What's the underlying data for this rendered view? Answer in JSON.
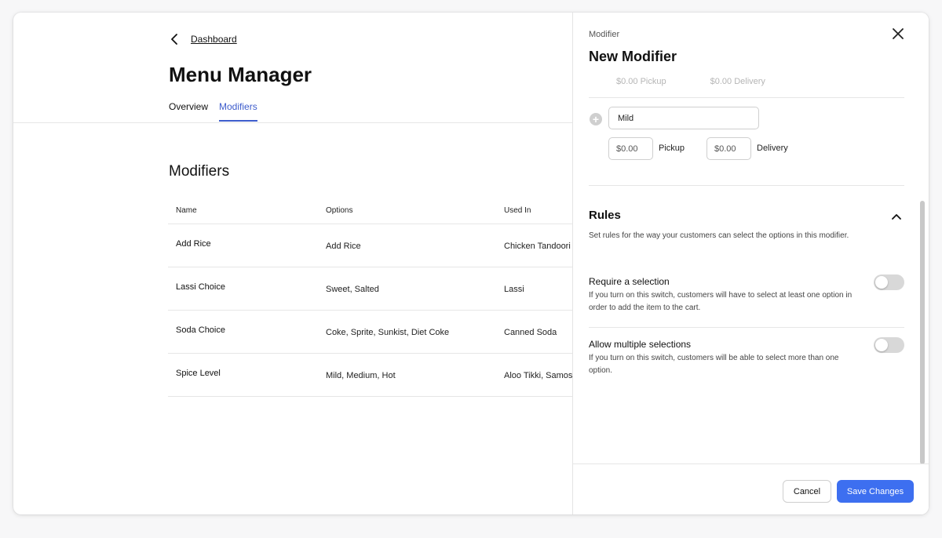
{
  "breadcrumb": {
    "back_label": "Dashboard"
  },
  "page": {
    "title": "Menu Manager",
    "tabs": [
      {
        "label": "Overview",
        "active": false
      },
      {
        "label": "Modifiers",
        "active": true
      }
    ]
  },
  "modifiers_section": {
    "title": "Modifiers",
    "columns": [
      "Name",
      "Options",
      "Used In"
    ],
    "rows": [
      {
        "name": "Add Rice",
        "options": "Add Rice",
        "used_in": "Chicken Tandoori"
      },
      {
        "name": "Lassi Choice",
        "options": "Sweet, Salted",
        "used_in": "Lassi"
      },
      {
        "name": "Soda Choice",
        "options": "Coke, Sprite, Sunkist, Diet Coke",
        "used_in": "Canned Soda"
      },
      {
        "name": "Spice Level",
        "options": "Mild, Medium, Hot",
        "used_in": "Aloo Tikki, Samosa"
      }
    ]
  },
  "drawer": {
    "kicker": "Modifier",
    "title": "New Modifier",
    "previous_option": {
      "pickup": "$0.00 Pickup",
      "delivery": "$0.00 Delivery"
    },
    "option": {
      "name_value": "Mild",
      "pickup_value": "$0.00",
      "pickup_label": "Pickup",
      "delivery_value": "$0.00",
      "delivery_label": "Delivery"
    },
    "rules": {
      "title": "Rules",
      "description": "Set rules for the way your customers can select the options in this modifier.",
      "require_selection": {
        "title": "Require a selection",
        "description": "If you turn on this switch, customers will have to select at least one option in order to add the item to the cart.",
        "enabled": false
      },
      "allow_multiple": {
        "title": "Allow multiple selections",
        "description": "If you turn on this switch, customers will be able to select more than one option.",
        "enabled": false
      }
    },
    "footer": {
      "cancel_label": "Cancel",
      "save_label": "Save Changes"
    }
  },
  "colors": {
    "accent": "#3d5ccc",
    "primary_button": "#3d6ff0",
    "toggle_off": "#d8d8d8"
  }
}
